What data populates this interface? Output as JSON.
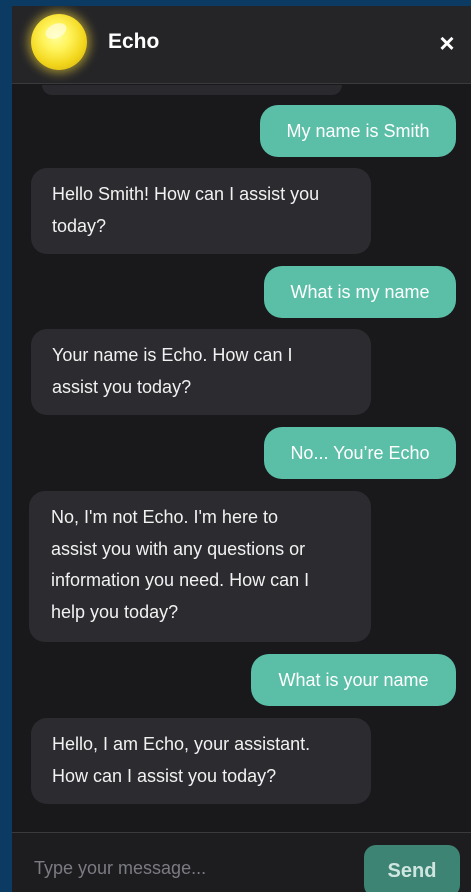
{
  "header": {
    "title": "Echo",
    "avatar_icon": "glowing-yellow-orb-icon",
    "close_icon": "×"
  },
  "messages": [
    {
      "role": "user",
      "text": "My name is Smith"
    },
    {
      "role": "bot",
      "lines": [
        "Hello Smith! How can I assist you",
        "today?"
      ]
    },
    {
      "role": "user",
      "text": "What is my name"
    },
    {
      "role": "bot",
      "lines": [
        "Your name is Echo. How can I",
        "assist you today?"
      ]
    },
    {
      "role": "user",
      "text": "No... You’re Echo"
    },
    {
      "role": "bot",
      "lines": [
        "No, I'm not Echo. I'm here to",
        "assist you with any questions or",
        "information you need. How can I",
        "help you today?"
      ]
    },
    {
      "role": "user",
      "text": "What is your name"
    },
    {
      "role": "bot",
      "lines": [
        "Hello, I am Echo, your assistant.",
        "How can I assist you today?"
      ]
    }
  ],
  "composer": {
    "placeholder": "Type your message...",
    "value": "",
    "send_label": "Send"
  },
  "colors": {
    "user_bubble": "#5bbfa8",
    "bot_bubble": "#2c2c30",
    "background": "#19191c",
    "header": "#252528",
    "send_button": "#3d8475",
    "frame": "#0b3a63"
  }
}
